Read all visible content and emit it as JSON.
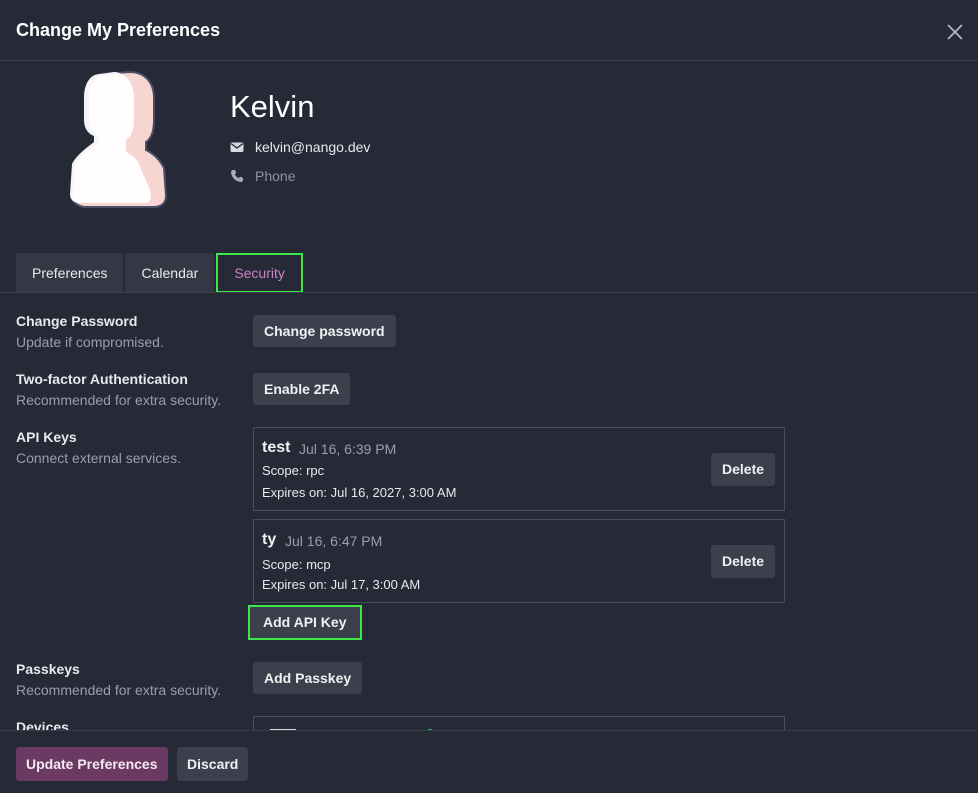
{
  "dialog": {
    "title": "Change My Preferences"
  },
  "profile": {
    "name": "Kelvin",
    "email": "kelvin@nango.dev",
    "phone_placeholder": "Phone"
  },
  "tabs": [
    {
      "label": "Preferences",
      "active": false
    },
    {
      "label": "Calendar",
      "active": false
    },
    {
      "label": "Security",
      "active": true
    }
  ],
  "security": {
    "change_password": {
      "title": "Change Password",
      "subtitle": "Update if compromised.",
      "button": "Change password"
    },
    "two_factor": {
      "title": "Two-factor Authentication",
      "subtitle": "Recommended for extra security.",
      "button": "Enable 2FA"
    },
    "api_keys": {
      "title": "API Keys",
      "subtitle": "Connect external services.",
      "keys": [
        {
          "name": "test",
          "created": "Jul 16, 6:39 PM",
          "scope": "Scope: rpc",
          "expires": "Expires on: Jul 16, 2027, 3:00 AM",
          "delete_label": "Delete"
        },
        {
          "name": "ty",
          "created": "Jul 16, 6:47 PM",
          "scope": "Scope: mcp",
          "expires": "Expires on: Jul 17, 3:00 AM",
          "delete_label": "Delete"
        }
      ],
      "add_button": "Add API Key"
    },
    "passkeys": {
      "title": "Passkeys",
      "subtitle": "Recommended for extra security.",
      "button": "Add Passkey"
    },
    "devices": {
      "title": "Devices"
    }
  },
  "footer": {
    "update_button": "Update Preferences",
    "discard_button": "Discard"
  },
  "colors": {
    "background": "#262a36",
    "active_tab_text": "#c882c8",
    "highlight_outline": "#3ee64b",
    "primary_button": "#6b3a63"
  }
}
